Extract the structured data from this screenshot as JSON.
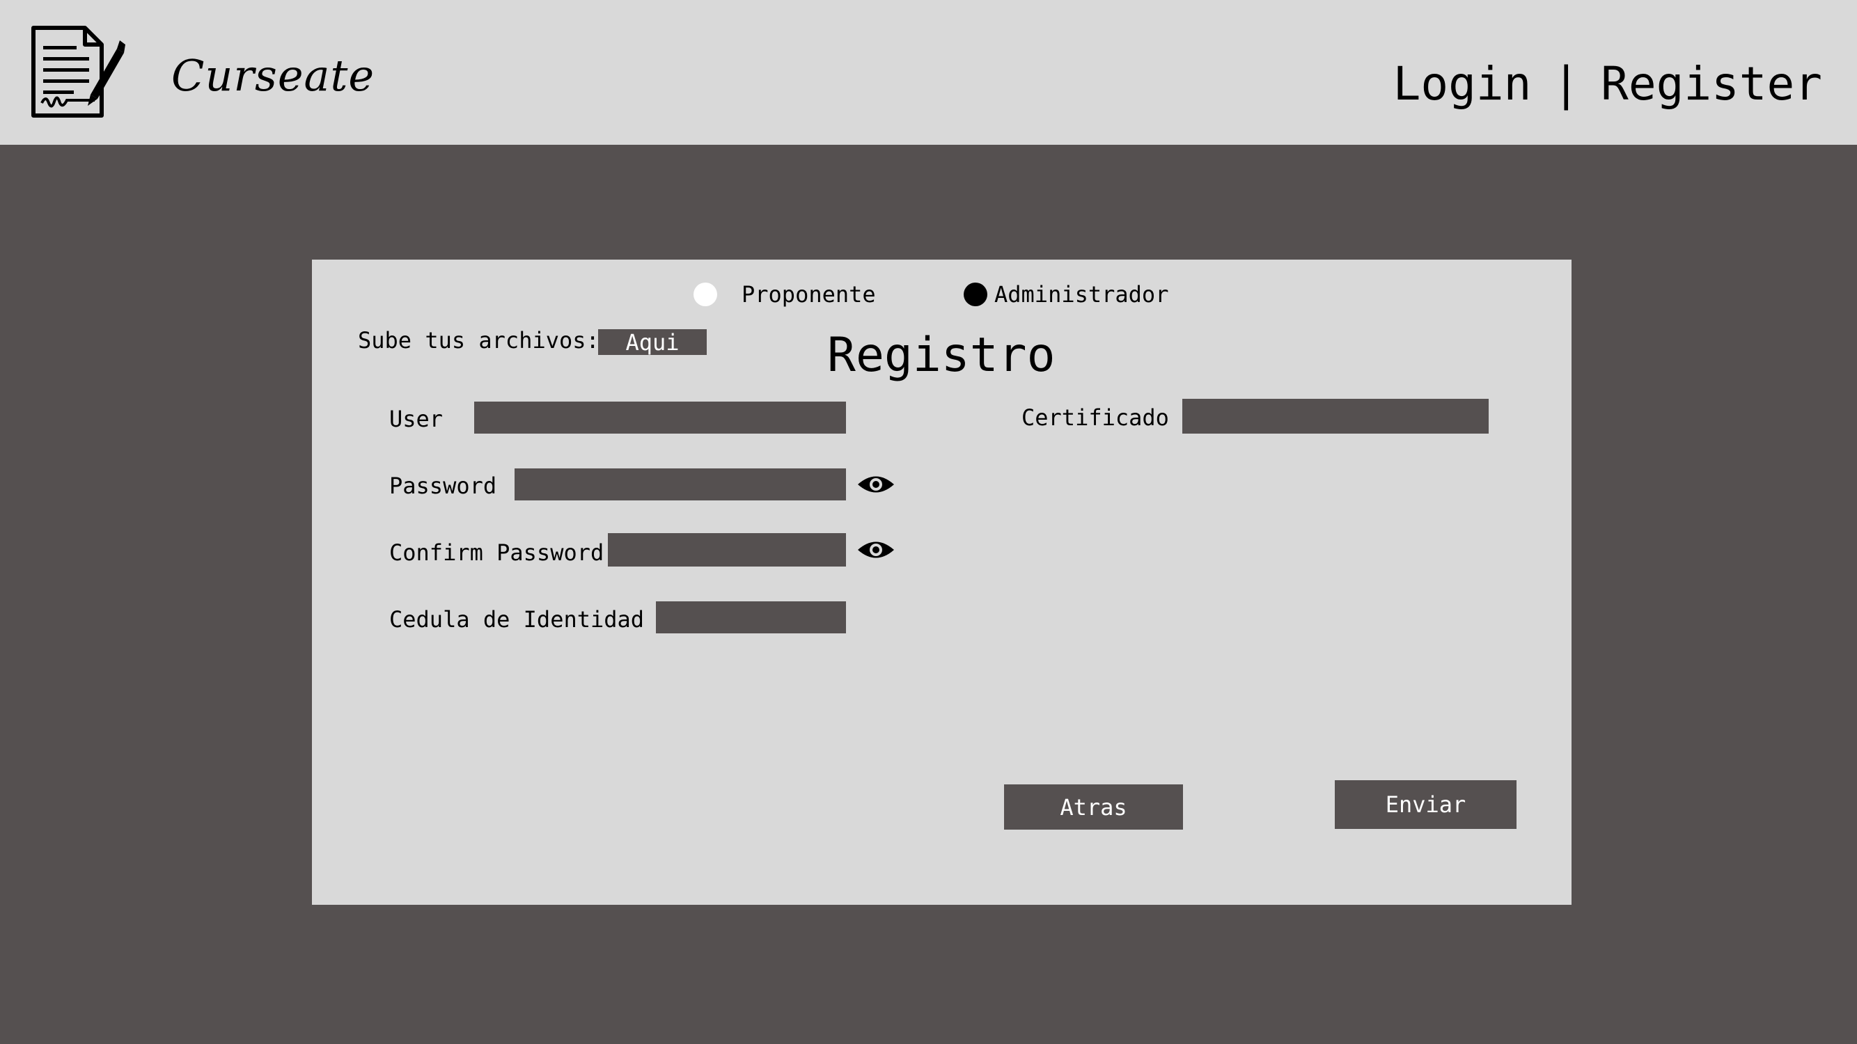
{
  "header": {
    "brand": "Curseate",
    "nav": {
      "login": "Login",
      "separator": "|",
      "register": "Register"
    },
    "logo_icon": "document-signature-icon"
  },
  "form": {
    "title": "Registro",
    "role_options": [
      {
        "label": "Proponente",
        "selected": false
      },
      {
        "label": "Administrador",
        "selected": true
      }
    ],
    "upload": {
      "label": "Sube tus archivos:",
      "button": "Aqui"
    },
    "fields": {
      "user": {
        "label": "User",
        "value": ""
      },
      "password": {
        "label": "Password",
        "value": ""
      },
      "confirm_password": {
        "label": "Confirm Password",
        "value": ""
      },
      "cedula": {
        "label": "Cedula de Identidad",
        "value": ""
      },
      "certificado": {
        "label": "Certificado",
        "value": ""
      }
    },
    "buttons": {
      "back": "Atras",
      "submit": "Enviar"
    },
    "icons": {
      "show_password": "eye-icon"
    }
  },
  "colors": {
    "background": "#555050",
    "panel": "#d9d9d9",
    "field": "#555050",
    "text": "#000000",
    "button_text": "#ffffff"
  }
}
